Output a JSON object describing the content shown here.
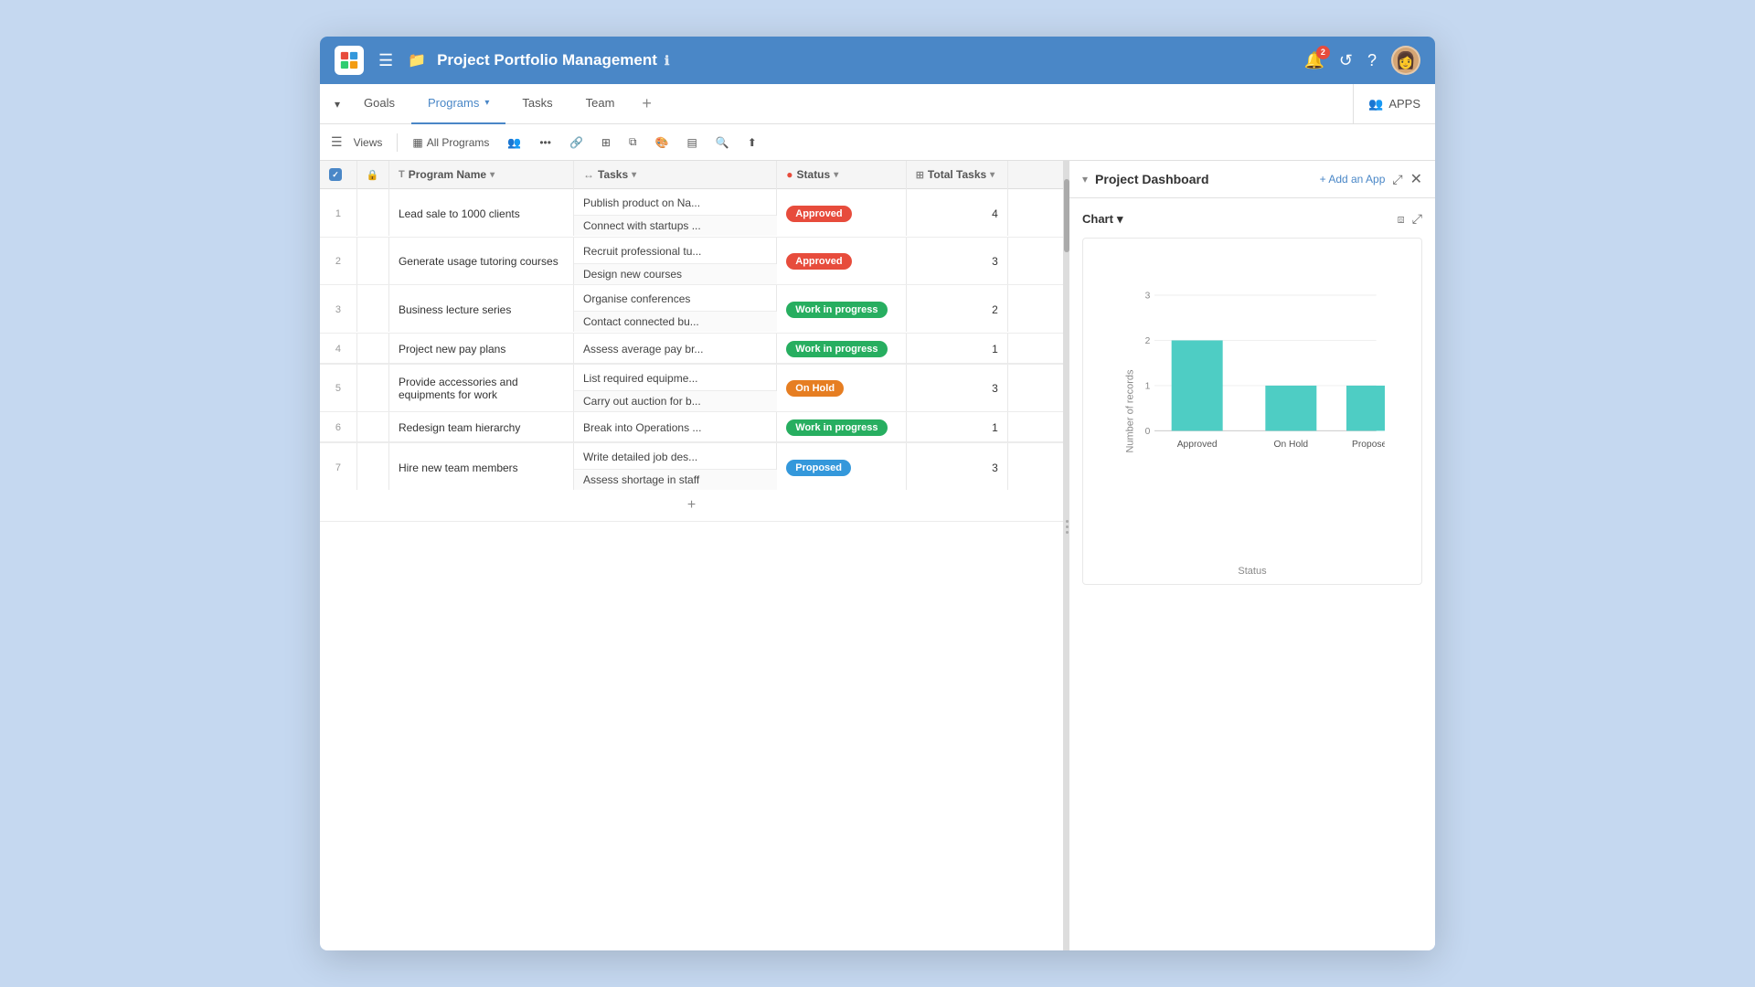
{
  "header": {
    "title": "Project Portfolio Management",
    "notification_count": "2",
    "logo_alt": "app-logo"
  },
  "tabs": [
    {
      "label": "Goals",
      "active": false
    },
    {
      "label": "Programs",
      "active": true,
      "has_arrow": true
    },
    {
      "label": "Tasks",
      "active": false
    },
    {
      "label": "Team",
      "active": false
    }
  ],
  "toolbar": {
    "views_label": "Views",
    "all_programs_label": "All Programs"
  },
  "table": {
    "columns": [
      {
        "label": "Program Name"
      },
      {
        "label": "Tasks"
      },
      {
        "label": "Status"
      },
      {
        "label": "Total Tasks"
      }
    ],
    "rows": [
      {
        "num": "1",
        "program": "Lead sale to 1000 clients",
        "tasks": [
          "Publish product on Na...",
          "Connect with startups ..."
        ],
        "status": "Approved",
        "status_type": "approved",
        "total": "4"
      },
      {
        "num": "2",
        "program": "Generate usage tutoring courses",
        "tasks": [
          "Recruit professional tu...",
          "Design new courses"
        ],
        "status": "Approved",
        "status_type": "approved",
        "total": "3"
      },
      {
        "num": "3",
        "program": "Business lecture series",
        "tasks": [
          "Organise conferences",
          "Contact connected bu..."
        ],
        "status": "Work in progress",
        "status_type": "wip",
        "total": "2"
      },
      {
        "num": "4",
        "program": "Project new pay plans",
        "tasks": [
          "Assess average pay br..."
        ],
        "status": "Work in progress",
        "status_type": "wip",
        "total": "1"
      },
      {
        "num": "5",
        "program": "Provide accessories and equipments for work",
        "tasks": [
          "List required equipme...",
          "Carry out auction for b..."
        ],
        "status": "On Hold",
        "status_type": "onhold",
        "total": "3"
      },
      {
        "num": "6",
        "program": "Redesign team hierarchy",
        "tasks": [
          "Break into Operations ..."
        ],
        "status": "Work in progress",
        "status_type": "wip",
        "total": "1"
      },
      {
        "num": "7",
        "program": "Hire new team members",
        "tasks": [
          "Write detailed job des...",
          "Assess shortage in staff"
        ],
        "status": "Proposed",
        "status_type": "proposed",
        "total": "3"
      }
    ]
  },
  "dashboard": {
    "title": "Project Dashboard",
    "add_app_label": "+ Add an App",
    "chart_label": "Chart",
    "chart": {
      "y_label": "Number of records",
      "x_label": "Status",
      "bars": [
        {
          "label": "Approved",
          "value": 2,
          "color": "#4ecdc4"
        },
        {
          "label": "On Hold",
          "value": 1,
          "color": "#4ecdc4"
        },
        {
          "label": "Proposed",
          "value": 1,
          "color": "#4ecdc4"
        }
      ],
      "max_value": 3,
      "y_ticks": [
        0,
        1,
        2,
        3
      ]
    }
  }
}
